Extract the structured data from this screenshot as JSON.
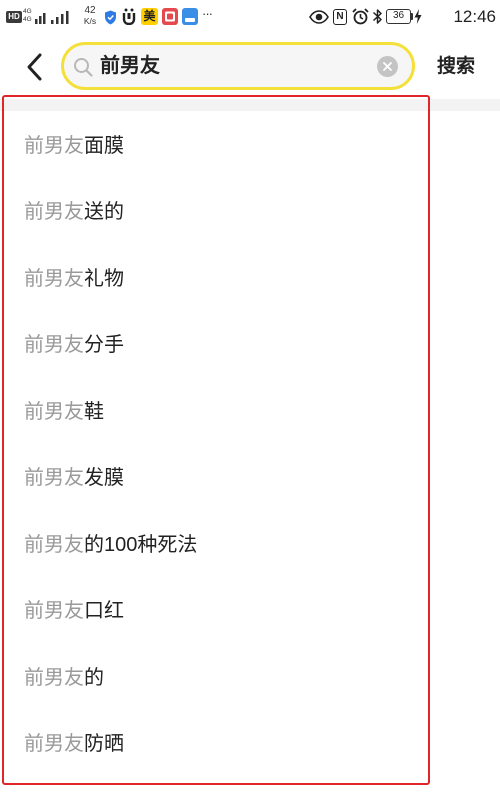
{
  "status_bar": {
    "hd_label": "HD",
    "sim1_label": "4G",
    "sim2_label": "4G",
    "speed_value": "42",
    "speed_unit": "K/s",
    "meituan_badge": "美",
    "more_label": "···",
    "nfc_label": "N",
    "battery_level": "36",
    "time": "12:46",
    "icons": {
      "left": [
        "signal-icon",
        "shield-icon",
        "app-notification-icon",
        "meituan-app-icon",
        "red-app-icon",
        "blue-app-icon"
      ],
      "right": [
        "eye-icon",
        "nfc-icon",
        "alarm-icon",
        "bluetooth-icon",
        "battery-icon",
        "charging-icon"
      ]
    }
  },
  "search": {
    "value": "前男友",
    "submit_label": "搜索",
    "icons": [
      "back-arrow-icon",
      "search-icon",
      "clear-icon"
    ]
  },
  "suggestions": [
    {
      "prefix": "前男友",
      "suffix": "面膜"
    },
    {
      "prefix": "前男友",
      "suffix": "送的"
    },
    {
      "prefix": "前男友",
      "suffix": "礼物"
    },
    {
      "prefix": "前男友",
      "suffix": "分手"
    },
    {
      "prefix": "前男友",
      "suffix": "鞋"
    },
    {
      "prefix": "前男友",
      "suffix": "发膜"
    },
    {
      "prefix": "前男友",
      "suffix": "的100种死法"
    },
    {
      "prefix": "前男友",
      "suffix": "口红"
    },
    {
      "prefix": "前男友",
      "suffix": "的"
    },
    {
      "prefix": "前男友",
      "suffix": "防晒"
    }
  ],
  "colors": {
    "search_border": "#f3e03a",
    "highlight_box": "#e0262a",
    "prefix_text": "#9a9a9a",
    "suffix_text": "#222222"
  }
}
